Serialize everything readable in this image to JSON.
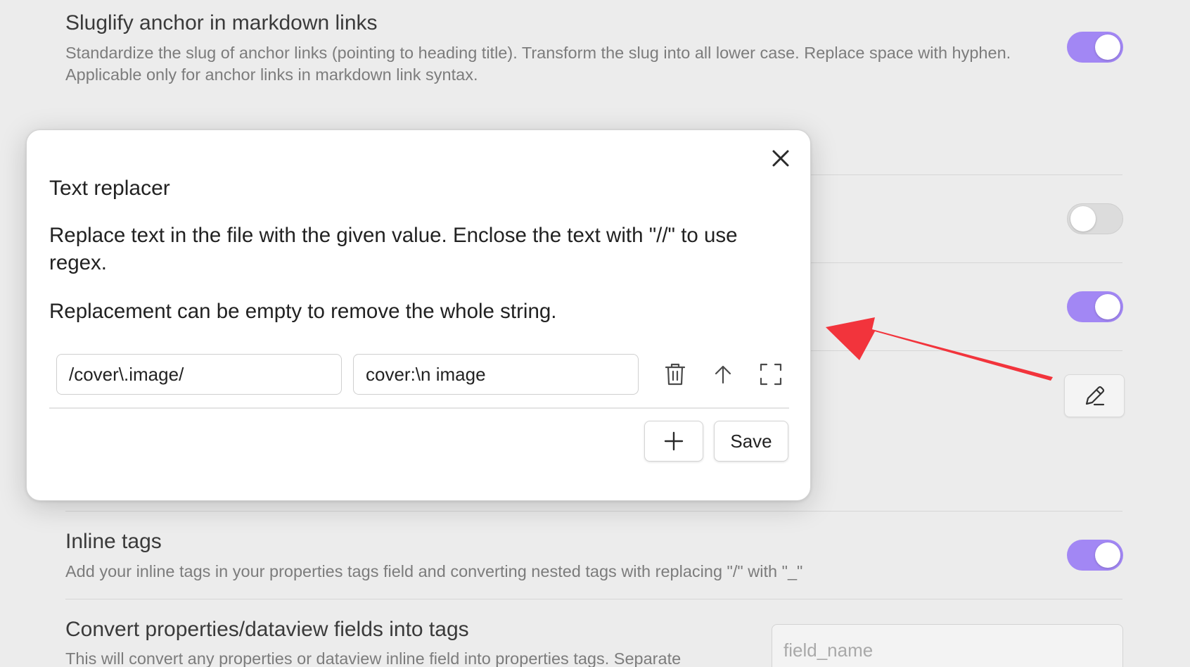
{
  "settings": {
    "sluglify": {
      "title": "Sluglify anchor in markdown links",
      "description": "Standardize the slug of anchor links (pointing to heading title). Transform the slug into all lower case. Replace space with hyphen. Applicable only for anchor links in markdown link syntax.",
      "enabled": true
    },
    "hidden_toggle_1": {
      "enabled": false
    },
    "hidden_toggle_2": {
      "enabled": true
    },
    "edit_icon": "pencil-icon",
    "inline_tags": {
      "title": "Inline tags",
      "description": "Add your inline tags in your properties tags field and converting nested tags with replacing \"/\" with \"_\"",
      "enabled": true
    },
    "convert_fields": {
      "title": "Convert properties/dataview fields into tags",
      "description": "This will convert any properties or dataview inline field into properties tags. Separate",
      "placeholder": "field_name"
    }
  },
  "modal": {
    "title": "Text replacer",
    "description_1": "Replace text in the file with the given value. Enclose the text with \"//\" to use regex.",
    "description_2": "Replacement can be empty to remove the whole string.",
    "close_icon": "close-icon",
    "rules": [
      {
        "find": "/cover\\.image/",
        "replace": "cover:\\n image",
        "icons": [
          "trash-icon",
          "arrow-up-icon",
          "expand-icon"
        ]
      }
    ],
    "add_button_icon": "plus-icon",
    "save_label": "Save"
  },
  "colors": {
    "accent": "#a287f4",
    "annotation_arrow": "#f2343c",
    "background": "#ececec",
    "modal_background": "#ffffff"
  }
}
